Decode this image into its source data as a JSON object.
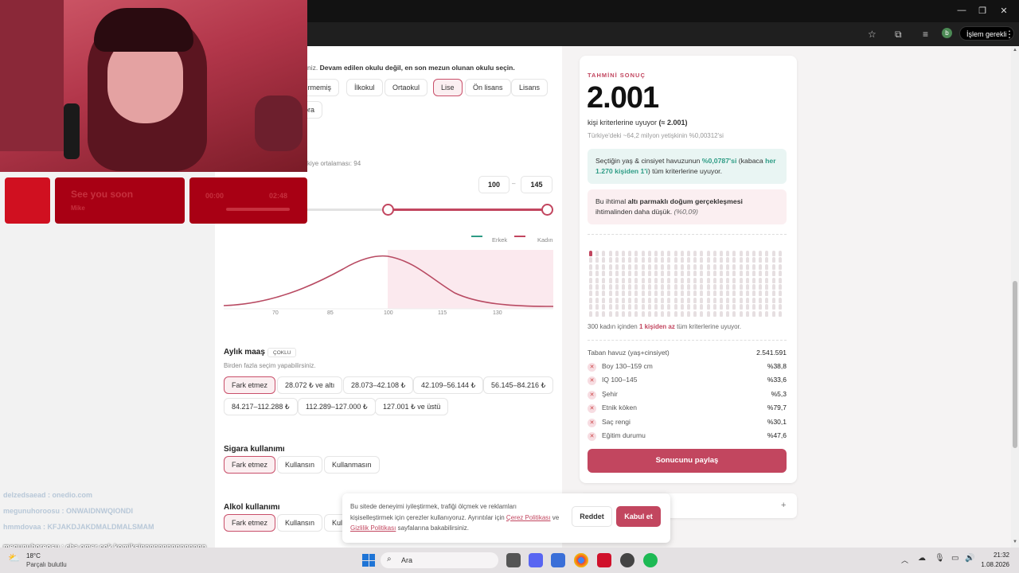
{
  "window": {
    "islem_label": "İşlem gerekli",
    "profile_initial": "b"
  },
  "education": {
    "hint_prefix": "niz. ",
    "hint_bold": "Devam edilen okulu değil, en son mezun olunan okulu seçin.",
    "options": [
      "tirmemiş",
      "İlkokul",
      "Ortaokul",
      "Lise",
      "Ön lisans",
      "Lisans",
      "ora"
    ],
    "selected": "Lise"
  },
  "iq": {
    "avg_hint": "kiye ortalaması: 94",
    "min": "100",
    "dash": "–",
    "max": "145",
    "legend": [
      "Erkek",
      "Kadın"
    ],
    "ticks": [
      "70",
      "85",
      "100",
      "115",
      "130"
    ]
  },
  "salary": {
    "title": "Aylık maaş",
    "badge": "ÇOKLU",
    "hint": "Birden fazla seçim yapabilirsiniz.",
    "options": [
      "Fark etmez",
      "28.072 ₺ ve altı",
      "28.073–42.108 ₺",
      "42.109–56.144 ₺",
      "56.145–84.216 ₺",
      "84.217–112.288 ₺",
      "112.289–127.000 ₺",
      "127.001 ₺ ve üstü"
    ],
    "selected": "Fark etmez"
  },
  "smoking": {
    "title": "Sigara kullanımı",
    "options": [
      "Fark etmez",
      "Kullansın",
      "Kullanmasın"
    ],
    "selected": "Fark etmez"
  },
  "alcohol": {
    "title": "Alkol kullanımı",
    "options": [
      "Fark etmez",
      "Kullansın",
      "Kul"
    ],
    "selected": "Fark etmez"
  },
  "result": {
    "label": "TAHMİNİ SONUÇ",
    "count": "2.001",
    "match_prefix": "kişi kriterlerine uyuyor ",
    "match_bold": "(≈ 2.001)",
    "pop_note": "Türkiye'deki ~64,2 milyon yetişkinin %0,00312'si",
    "green_1": "Seçtiğin yaş & cinsiyet havuzunun ",
    "green_pct": "%0,0787'si",
    "green_2": " (kabaca ",
    "green_bold": "her 1.270 kişiden 1'i",
    "green_3": ") tüm kriterlerine uyuyor.",
    "pink_1": "Bu ihtimal ",
    "pink_bold": "altı parmaklı doğum gerçekleşmesi",
    "pink_2": " ihtimalinden daha düşük. ",
    "pink_pct": "(%0,09)",
    "icons_note_1": "300 kadın içinden ",
    "icons_note_bold": "1 kişiden az",
    "icons_note_2": " tüm kriterlerine uyuyor.",
    "base_label": "Taban havuz (yaş+cinsiyet)",
    "base_value": "2.541.591",
    "criteria": [
      {
        "label": "Boy 130–159 cm",
        "value": "%38,8"
      },
      {
        "label": "IQ 100–145",
        "value": "%33,6"
      },
      {
        "label": "Şehir",
        "value": "%5,3"
      },
      {
        "label": "Etnik köken",
        "value": "%79,7"
      },
      {
        "label": "Saç rengi",
        "value": "%30,1"
      },
      {
        "label": "Eğitim durumu",
        "value": "%47,6"
      }
    ],
    "share": "Sonucunu paylaş",
    "accordion_plus": "+"
  },
  "cookie": {
    "line1": "Bu sitede deneyimi iyileştirmek, trafiği ölçmek ve reklamları",
    "line2": "kişiselleştirmek için çerezler kullanıyoruz. Ayrıntılar için ",
    "link1": "Çerez Politikası",
    "and": " ve",
    "link2": "Gizlilik Politikası",
    "line3": " sayfalarına bakabilirsiniz.",
    "reject": "Reddet",
    "accept": "Kabul et"
  },
  "overlay": {
    "song": "See you soon",
    "artist": "Mike",
    "time_a": "00:00",
    "time_b": "02:48"
  },
  "chat": [
    "delzedsaead : onedio.com",
    "megunuhoroosu : ONWAIDNWQIONDI",
    "hmmdovaa : KFJAKDJAKDMALDMALSMAM",
    "megunuhoreosu : cha omer cok komiksinnnnnnnnnnnnnnn"
  ],
  "taskbar": {
    "temp": "18°C",
    "weather": "Parçalı bulutlu",
    "search": "Ara",
    "time": "21:32",
    "date": "1.08.2026"
  },
  "colors": {
    "accent": "#c2465f",
    "green": "#2e9c85",
    "pink_bg": "#fbeff1",
    "green_bg": "#e9f5f3"
  }
}
